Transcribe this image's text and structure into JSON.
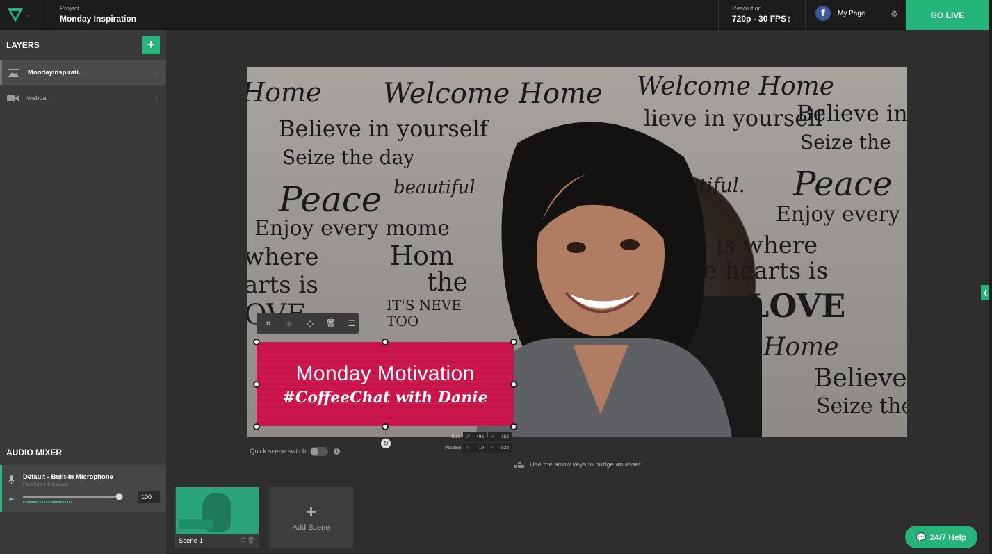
{
  "header": {
    "project_label": "Project",
    "project_name": "Monday Inspiration",
    "resolution_label": "Resolution",
    "resolution_value": "720p - 30 FPS",
    "destination_name": "My Page",
    "go_live_label": "GO LIVE",
    "facebook_glyph": "f"
  },
  "layers": {
    "title": "LAYERS",
    "add_glyph": "+",
    "items": [
      {
        "label": "MondayInspirati...",
        "icon": "image-icon",
        "active": true
      },
      {
        "label": "webcam",
        "icon": "camera-icon",
        "active": false
      }
    ]
  },
  "audio": {
    "title": "AUDIO MIXER",
    "device_name": "Default - Built-in Microphone",
    "device_sub": "FaceTime HD Camera",
    "volume": "100"
  },
  "overlay": {
    "line1": "Monday Motivation",
    "line2": "#CoffeeChat with Danie",
    "bg_color": "#c8144a"
  },
  "transform": {
    "size_label": "Size",
    "w_key": "W",
    "w_value": "496",
    "h_key": "H",
    "h_value": "162",
    "position_label": "Position",
    "x_key": "X",
    "x_value": "19",
    "y_key": "Y",
    "y_value": "538"
  },
  "canvas_footer": {
    "quick_switch_label": "Quick scene switch",
    "hint": "Use the arrow keys to nudge an asset."
  },
  "scenes": {
    "items": [
      {
        "label": "Scene 1"
      }
    ],
    "add_label": "Add Scene"
  },
  "help_label": "24/7 Help",
  "colors": {
    "accent": "#25b47a",
    "topbar": "#1c1c1c",
    "sidebar": "#3a3a3a",
    "workspace": "#2e2e2e"
  }
}
